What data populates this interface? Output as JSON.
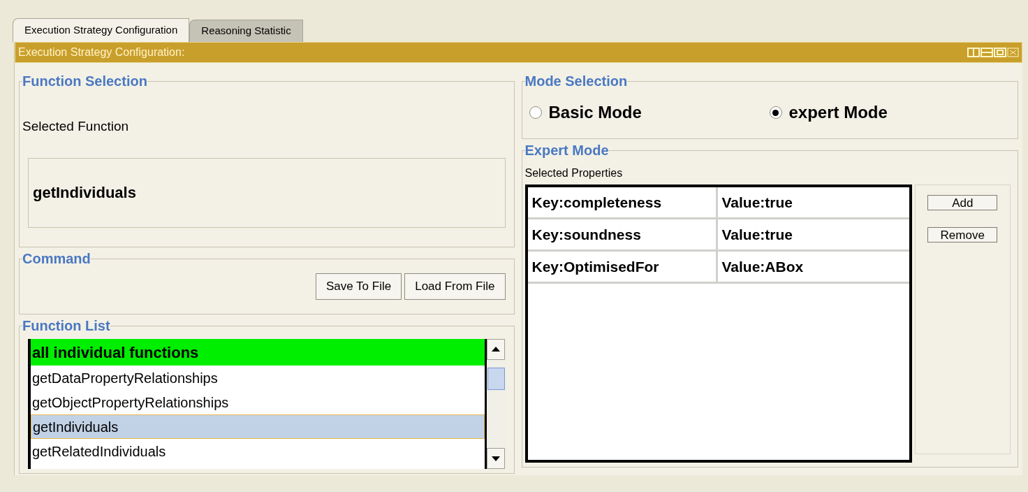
{
  "tabs": [
    {
      "label": "Execution Strategy Configuration",
      "selected": true
    },
    {
      "label": "Reasoning Statistic",
      "selected": false
    }
  ],
  "panel": {
    "title": "Execution Strategy Configuration:"
  },
  "function_selection": {
    "legend": "Function Selection",
    "label": "Selected Function",
    "value": "getIndividuals"
  },
  "command": {
    "legend": "Command",
    "buttons": [
      "Save To File",
      "Load From File"
    ]
  },
  "function_list": {
    "legend": "Function List",
    "items": [
      {
        "label": "all individual functions",
        "kind": "group",
        "selected": false
      },
      {
        "label": "getDataPropertyRelationships",
        "kind": "function",
        "selected": false
      },
      {
        "label": "getObjectPropertyRelationships",
        "kind": "function",
        "selected": false
      },
      {
        "label": "getIndividuals",
        "kind": "function",
        "selected": true
      },
      {
        "label": "getRelatedIndividuals",
        "kind": "function",
        "selected": false
      }
    ]
  },
  "mode_selection": {
    "legend": "Mode Selection",
    "options": [
      {
        "label": "Basic Mode",
        "selected": false
      },
      {
        "label": "expert Mode",
        "selected": true
      }
    ]
  },
  "expert_mode": {
    "legend": "Expert Mode",
    "label": "Selected Properties",
    "rows": [
      {
        "key": "Key:completeness",
        "value": "Value:true"
      },
      {
        "key": "Key:soundness",
        "value": "Value:true"
      },
      {
        "key": "Key:OptimisedFor",
        "value": "Value:ABox"
      }
    ],
    "buttons": [
      "Add",
      "Remove"
    ]
  }
}
